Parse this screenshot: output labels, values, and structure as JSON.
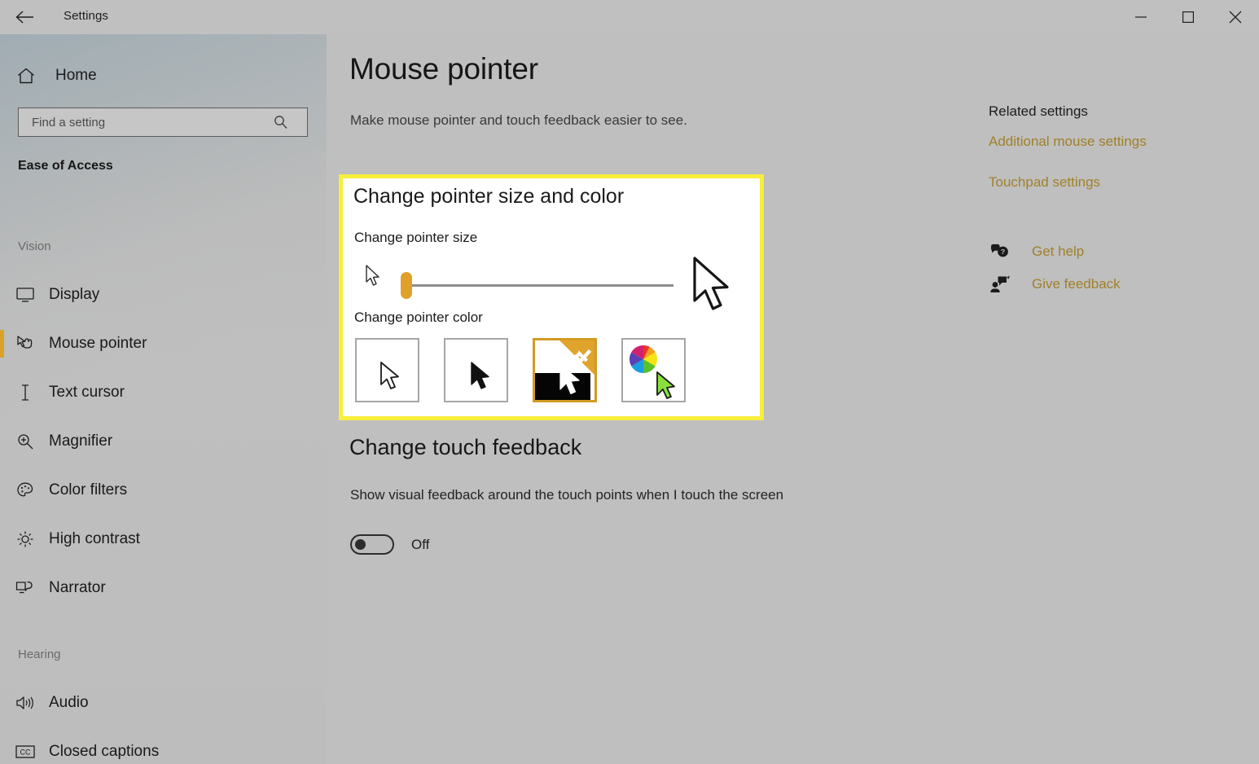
{
  "window": {
    "title": "Settings",
    "back_icon": "back-arrow-icon",
    "controls": [
      {
        "name": "minimize",
        "glyph": "minimize-icon"
      },
      {
        "name": "maximize",
        "glyph": "maximize-icon"
      },
      {
        "name": "close",
        "glyph": "close-icon"
      }
    ]
  },
  "sidebar": {
    "home_label": "Home",
    "home_icon": "home-icon",
    "search": {
      "placeholder": "Find a setting",
      "value": "",
      "icon": "search-icon"
    },
    "category": "Ease of Access",
    "groups": [
      {
        "label": "Vision",
        "items": [
          {
            "label": "Display",
            "icon": "monitor-icon",
            "selected": false
          },
          {
            "label": "Mouse pointer",
            "icon": "mouse-pointer-hand-icon",
            "selected": true
          },
          {
            "label": "Text cursor",
            "icon": "text-cursor-icon",
            "selected": false
          },
          {
            "label": "Magnifier",
            "icon": "magnifier-icon",
            "selected": false
          },
          {
            "label": "Color filters",
            "icon": "palette-icon",
            "selected": false
          },
          {
            "label": "High contrast",
            "icon": "brightness-icon",
            "selected": false
          },
          {
            "label": "Narrator",
            "icon": "narrator-icon",
            "selected": false
          }
        ]
      },
      {
        "label": "Hearing",
        "items": [
          {
            "label": "Audio",
            "icon": "speaker-icon",
            "selected": false
          },
          {
            "label": "Closed captions",
            "icon": "closed-captions-icon",
            "selected": false
          }
        ]
      }
    ]
  },
  "main": {
    "page_title": "Mouse pointer",
    "page_subtitle": "Make mouse pointer and touch feedback easier to see.",
    "pointer_card": {
      "heading": "Change pointer size and color",
      "size_label": "Change pointer size",
      "size_value": 1,
      "size_min": 1,
      "size_max": 15,
      "color_label": "Change pointer color",
      "swatches": [
        {
          "name": "white-pointer",
          "selected": false
        },
        {
          "name": "black-pointer",
          "selected": false
        },
        {
          "name": "inverted-pointer",
          "selected": true
        },
        {
          "name": "custom-color-pointer",
          "selected": false
        }
      ]
    },
    "touch_feedback": {
      "heading": "Change touch feedback",
      "description": "Show visual feedback around the touch points when I touch the screen",
      "toggle_state": "Off",
      "toggle_on": false
    }
  },
  "right": {
    "related_title": "Related settings",
    "links": [
      {
        "label": "Additional mouse settings"
      },
      {
        "label": "Touchpad settings"
      }
    ],
    "help": [
      {
        "label": "Get help",
        "icon": "help-bubble-icon"
      },
      {
        "label": "Give feedback",
        "icon": "feedback-person-icon"
      }
    ]
  },
  "colors": {
    "accent": "#d9a32a",
    "highlight": "#f7ef3a",
    "link": "#a0802a",
    "window_bg": "#bfbfbf",
    "card_bg": "#ffffff"
  }
}
